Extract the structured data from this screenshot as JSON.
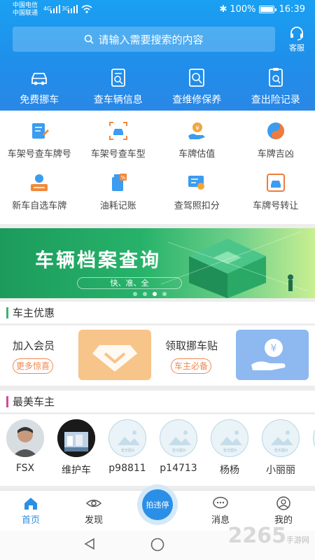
{
  "status": {
    "carrier1": "中国电信",
    "carrier2": "中国联通",
    "net1": "4G",
    "net2": "3G",
    "battery": "100%",
    "time": "16:39"
  },
  "search": {
    "placeholder": "请输入需要搜索的内容"
  },
  "service": {
    "label": "客服"
  },
  "top_actions": [
    {
      "label": "免费挪车",
      "icon": "car-move-icon"
    },
    {
      "label": "查车辆信息",
      "icon": "doc-search-icon"
    },
    {
      "label": "查维修保养",
      "icon": "repair-search-icon"
    },
    {
      "label": "查出险记录",
      "icon": "accident-record-icon"
    }
  ],
  "grid": [
    {
      "label": "车架号查车牌号",
      "icon": "vin-plate-icon",
      "color": "#3b9cf0"
    },
    {
      "label": "车架号查车型",
      "icon": "car-scan-icon",
      "color": "#f08a3c"
    },
    {
      "label": "车牌估值",
      "icon": "valuation-icon",
      "color": "#f0a63c"
    },
    {
      "label": "车牌吉凶",
      "icon": "yinyang-icon",
      "color": "#f07b3c"
    },
    {
      "label": "新车自选车牌",
      "icon": "select-plate-icon",
      "color": "#3b9cf0"
    },
    {
      "label": "油耗记账",
      "icon": "fuel-icon",
      "color": "#3b9cf0"
    },
    {
      "label": "查驾照扣分",
      "icon": "license-icon",
      "color": "#f0a63c"
    },
    {
      "label": "车牌号转让",
      "icon": "transfer-icon",
      "color": "#f07b3c"
    }
  ],
  "banner": {
    "title": "车辆档案查询",
    "subtitle": "快、准、全"
  },
  "promo_section": {
    "title": "车主优惠",
    "bar_color": "#3cb371"
  },
  "promo": [
    {
      "title": "加入会员",
      "button": "更多惊喜",
      "card_color": "#f7c48a",
      "icon": "diamond-icon"
    },
    {
      "title": "领取挪车贴",
      "button": "车主必备",
      "card_color": "#8eb8f0",
      "icon": "coin-hand-icon"
    }
  ],
  "users_section": {
    "title": "最美车主",
    "bar_color": "#d6469b"
  },
  "users": [
    {
      "name": "FSX"
    },
    {
      "name": "维护车"
    },
    {
      "name": "p98811"
    },
    {
      "name": "p14713"
    },
    {
      "name": "杨杨"
    },
    {
      "name": "小丽丽"
    }
  ],
  "placeholder_caption": "暂无图片",
  "tabs": [
    {
      "label": "首页",
      "icon": "home-icon",
      "active": true
    },
    {
      "label": "发现",
      "icon": "eye-icon"
    },
    {
      "label": "消息",
      "icon": "chat-icon"
    },
    {
      "label": "我的",
      "icon": "user-icon"
    }
  ],
  "fab": {
    "label": "拍违停"
  },
  "watermark": {
    "main": "2265",
    "sub": "手游网"
  },
  "colors": {
    "primary": "#2a8fe6",
    "accent": "#f0864e"
  }
}
